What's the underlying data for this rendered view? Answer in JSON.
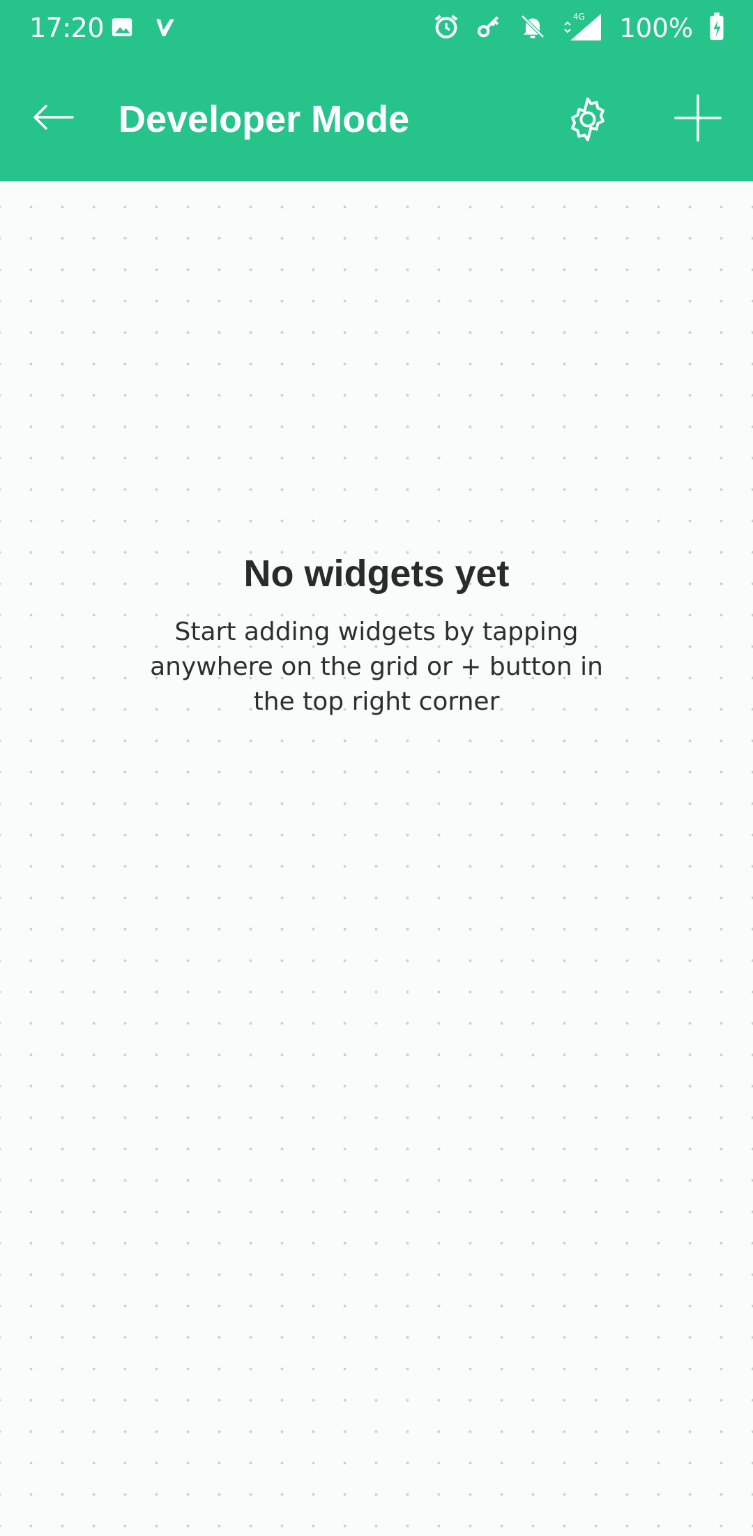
{
  "status_bar": {
    "time": "17:20",
    "battery": "100%",
    "network": "4G",
    "icons": [
      "image-icon",
      "check-app-icon",
      "alarm-icon",
      "key-icon",
      "bell-off-icon",
      "signal-icon",
      "battery-charging-icon"
    ]
  },
  "app_bar": {
    "title": "Developer Mode",
    "back_icon": "arrow-left-icon",
    "settings_icon": "gear-icon",
    "add_icon": "plus-icon"
  },
  "empty_state": {
    "title": "No widgets yet",
    "subtitle": "Start adding widgets by tapping anywhere on the grid or + button in the top right corner"
  },
  "colors": {
    "accent": "#26c48b",
    "background": "#fafbfb",
    "text": "#2a2a2a",
    "grid_dot": "#c9cdce"
  }
}
